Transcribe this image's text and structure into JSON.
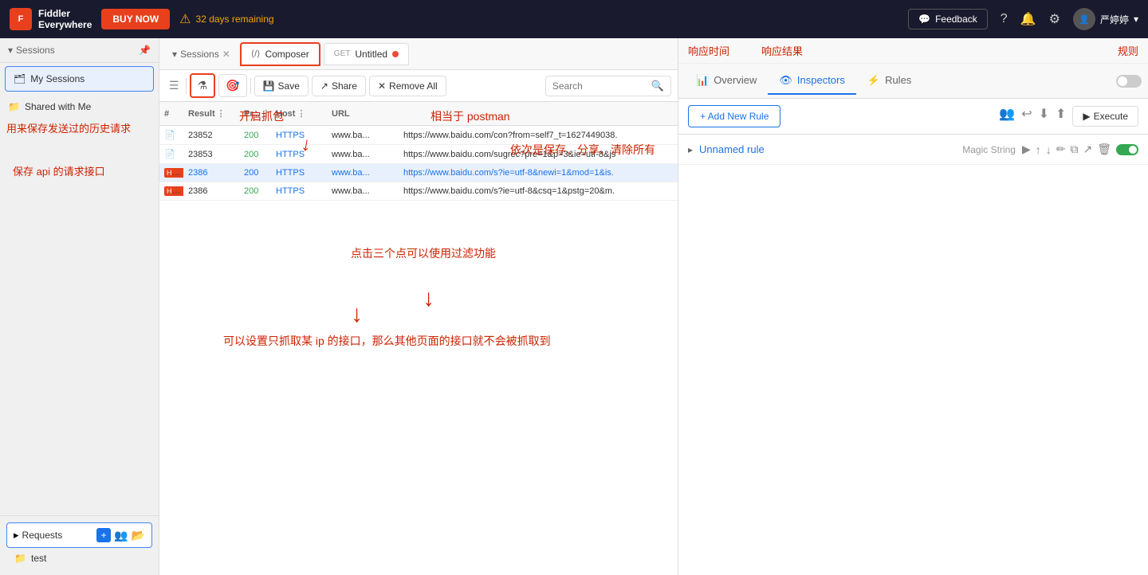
{
  "topbar": {
    "logo_line1": "Fiddler",
    "logo_line2": "Everywhere",
    "logo_initial": "F",
    "buy_now": "BUY NOW",
    "trial": "32 days remaining",
    "feedback": "Feedback",
    "user_name": "严婷婷"
  },
  "sidebar": {
    "sessions_label": "Sessions",
    "my_sessions": "My Sessions",
    "shared_with_me": "Shared with Me",
    "annotation1": "用来保存发送过的历史请求",
    "requests_label": "Requests",
    "test_folder": "test"
  },
  "toolbar": {
    "save": "Save",
    "share": "Share",
    "remove_all": "Remove All",
    "search_placeholder": "Search"
  },
  "tabs": {
    "sessions": "Sessions",
    "composer": "Composer",
    "untitled": "Untitled"
  },
  "table": {
    "headers": [
      "#",
      "↑",
      "Result",
      "Pr...",
      "Host",
      "URL"
    ],
    "rows": [
      {
        "id": "23852",
        "result": "200",
        "protocol": "HTTPS",
        "host": "www.ba...",
        "url": "https://www.baidu.com/con?from=self7_t=1627449038.",
        "selected": false,
        "html": false
      },
      {
        "id": "23853",
        "result": "200",
        "protocol": "HTTPS",
        "host": "www.ba...",
        "url": "https://www.baidu.com/sugrec?pre=1&p=3&ie=utf-8&js",
        "selected": false,
        "html": false
      },
      {
        "id": "2386",
        "result": "200",
        "protocol": "HTTPS",
        "host": "www.ba...",
        "url": "https://www.baidu.com/s?ie=utf-8&newi=1&mod=1&is.",
        "selected": true,
        "html": true
      },
      {
        "id": "2386",
        "result": "200",
        "protocol": "HTTPS",
        "host": "www.ba...",
        "url": "https://www.baidu.com/s?ie=utf-8&csq=1&pstg=20&m.",
        "selected": false,
        "html": true
      }
    ]
  },
  "right_panel": {
    "overview_tab": "Overview",
    "inspectors_tab": "Inspectors",
    "rules_tab": "Rules",
    "add_rule_label": "+ Add New Rule",
    "execute_label": "Execute",
    "rule_name": "Unnamed rule",
    "rule_type": "Magic String"
  },
  "annotations": {
    "capture": "开启抓包",
    "postman": "相当于 postman",
    "save_history": "用来保存发送过的历史请求",
    "save_share_clear": "依次是保存、分享、清除所有",
    "three_dots": "点击三个点可以使用过滤功能",
    "filter_ip": "可以设置只抓取某 ip 的接口，那么其他页面的接口就不会被抓取到",
    "save_api": "保存 api 的请求接口",
    "response_time": "响应时间",
    "response_result": "响应结果",
    "rules_label": "规则"
  }
}
